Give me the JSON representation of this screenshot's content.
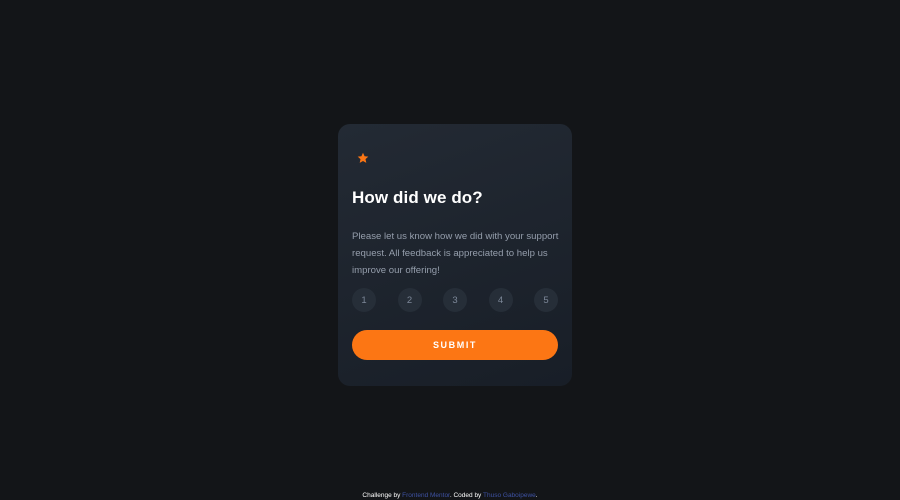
{
  "card": {
    "icon": "star-icon",
    "title": "How did we do?",
    "description": "Please let us know how we did with your support request. All feedback is appreciated to help us improve our offering!",
    "ratings": [
      "1",
      "2",
      "3",
      "4",
      "5"
    ],
    "submit_label": "SUBMIT"
  },
  "footer": {
    "challenge_prefix": "Challenge by",
    "challenge_link": "Frontend Mentor",
    "coded_prefix": ". Coded by",
    "coder_link": "Thuso Gaboipewe",
    "suffix": "."
  },
  "colors": {
    "background": "#131518",
    "card_start": "#232a34",
    "card_end": "#181e27",
    "accent": "#fc7614",
    "rating_bg": "#262e38",
    "rating_text": "#7c8798",
    "description_text": "#959eac",
    "link": "#3e52a3"
  }
}
